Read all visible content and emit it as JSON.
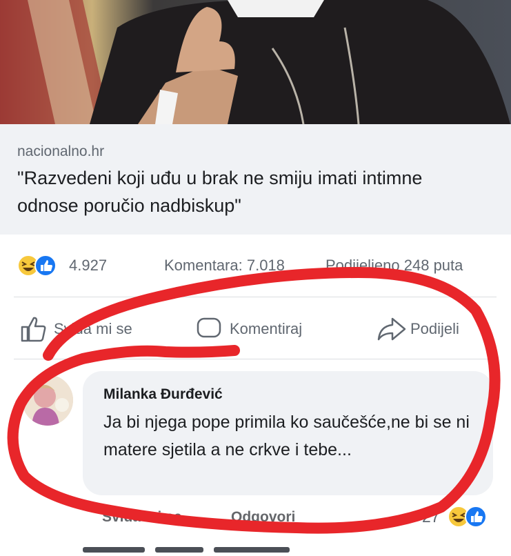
{
  "link_preview": {
    "domain": "nacionalno.hr",
    "title": "\"Razvedeni koji uđu u brak ne smiju imati intimne odnose poručio nadbiskup\""
  },
  "stats": {
    "reactions": "4.927",
    "comments": "Komentara: 7.018",
    "shares": "Podijeljeno 248 puta"
  },
  "actions": {
    "like": "Sviđa mi se",
    "comment": "Komentiraj",
    "share": "Podijeli"
  },
  "comment": {
    "author": "Milanka Đurđević",
    "text": "Ja bi njega pope primila ko saučešće,ne bi se ni matere sjetila a ne crkve i tebe...",
    "like_label": "Sviđa mi se",
    "reply_label": "Odgovori",
    "reaction_count": "27"
  },
  "icons": {
    "reactions": [
      "laugh-emoji-icon",
      "like-thumb-icon"
    ],
    "actions": [
      "thumbs-up-icon",
      "comment-bubble-icon",
      "share-arrow-icon"
    ]
  },
  "colors": {
    "facebook_blue": "#1877f2",
    "emoji_yellow": "#f7c83c",
    "annotation_red": "#e8262a"
  }
}
